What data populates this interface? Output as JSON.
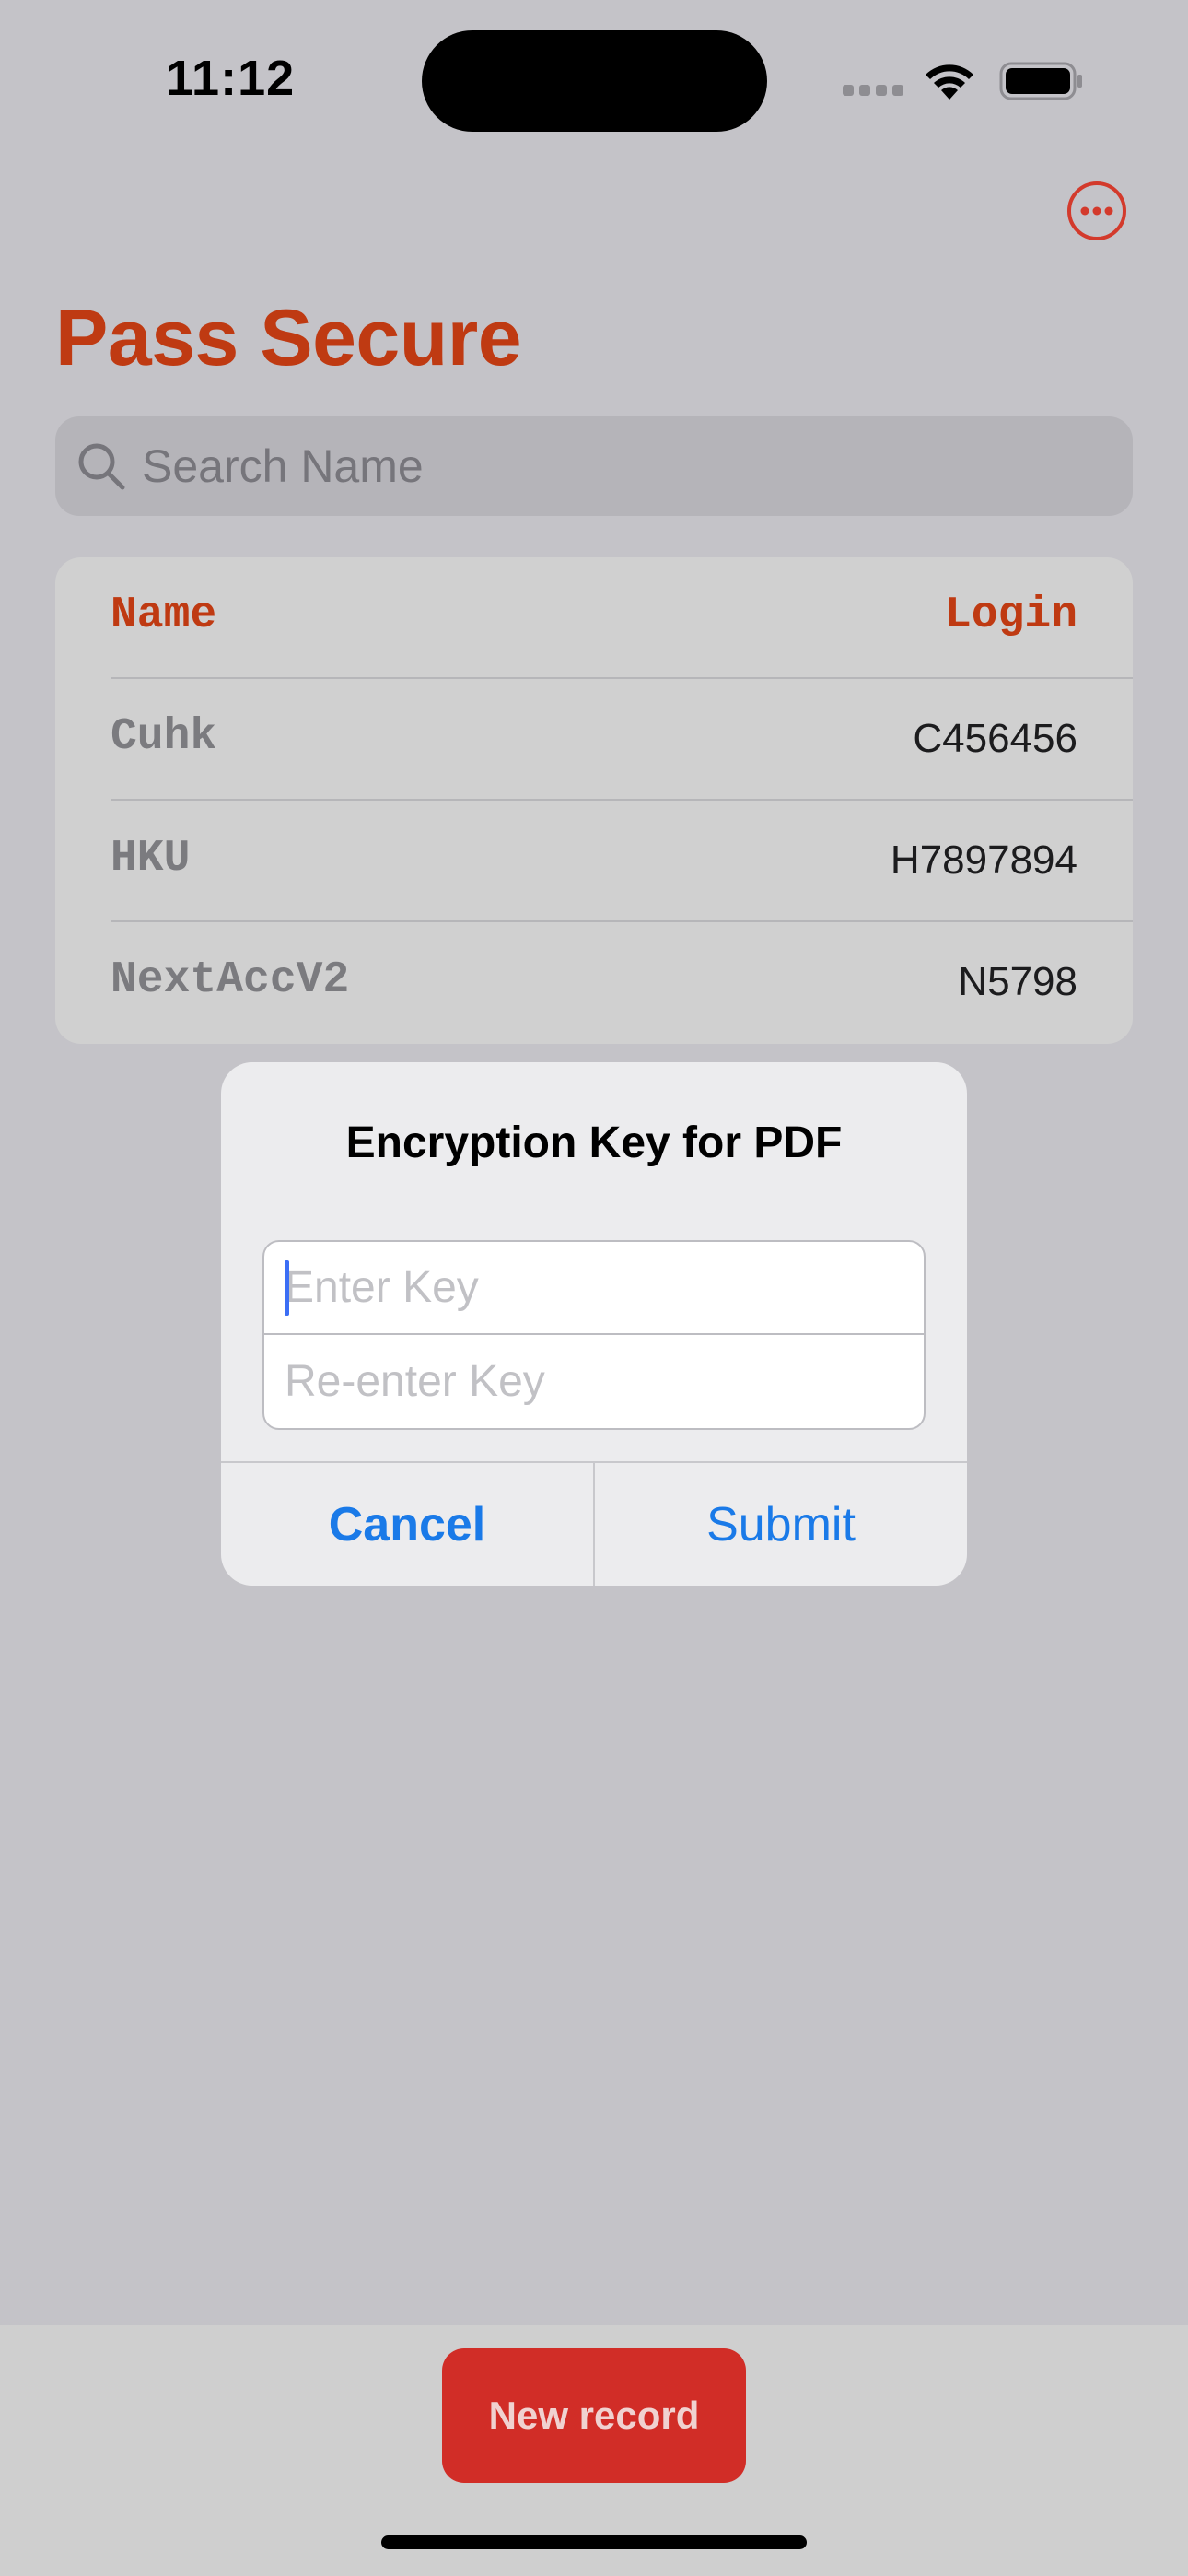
{
  "status_bar": {
    "time": "11:12"
  },
  "app": {
    "title": "Pass Secure",
    "accent_color": "#bf3a12",
    "more_icon": "ellipsis-circle-icon"
  },
  "search": {
    "placeholder": "Search Name",
    "icon": "magnifying-glass-icon"
  },
  "table": {
    "headers": {
      "name": "Name",
      "login": "Login"
    },
    "rows": [
      {
        "name": "Cuhk",
        "login": "C456456"
      },
      {
        "name": "HKU",
        "login": "H7897894"
      },
      {
        "name": "NextAccV2",
        "login": "N5798"
      }
    ]
  },
  "dialog": {
    "title": "Encryption Key for PDF",
    "key_placeholder": "Enter Key",
    "rekey_placeholder": "Re-enter Key",
    "cancel_label": "Cancel",
    "submit_label": "Submit",
    "button_color": "#1a7ae8"
  },
  "footer": {
    "new_record_label": "New record",
    "button_color": "#d12d27"
  }
}
